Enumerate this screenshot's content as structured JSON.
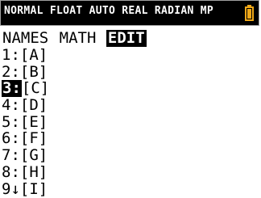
{
  "status": {
    "text": "NORMAL FLOAT AUTO REAL RADIAN MP",
    "battery_icon": "battery-icon",
    "battery_color": "#f0a818"
  },
  "menu": {
    "tabs": [
      {
        "label": "NAMES",
        "active": false
      },
      {
        "label": "MATH",
        "active": false
      },
      {
        "label": "EDIT",
        "active": true
      }
    ]
  },
  "items": [
    {
      "num": "1:",
      "label": "[A]",
      "selected": false
    },
    {
      "num": "2:",
      "label": "[B]",
      "selected": false
    },
    {
      "num": "3:",
      "label": "[C]",
      "selected": true
    },
    {
      "num": "4:",
      "label": "[D]",
      "selected": false
    },
    {
      "num": "5:",
      "label": "[E]",
      "selected": false
    },
    {
      "num": "6:",
      "label": "[F]",
      "selected": false
    },
    {
      "num": "7:",
      "label": "[G]",
      "selected": false
    },
    {
      "num": "8:",
      "label": "[H]",
      "selected": false
    },
    {
      "num": "9↓",
      "label": "[I]",
      "selected": false
    }
  ]
}
